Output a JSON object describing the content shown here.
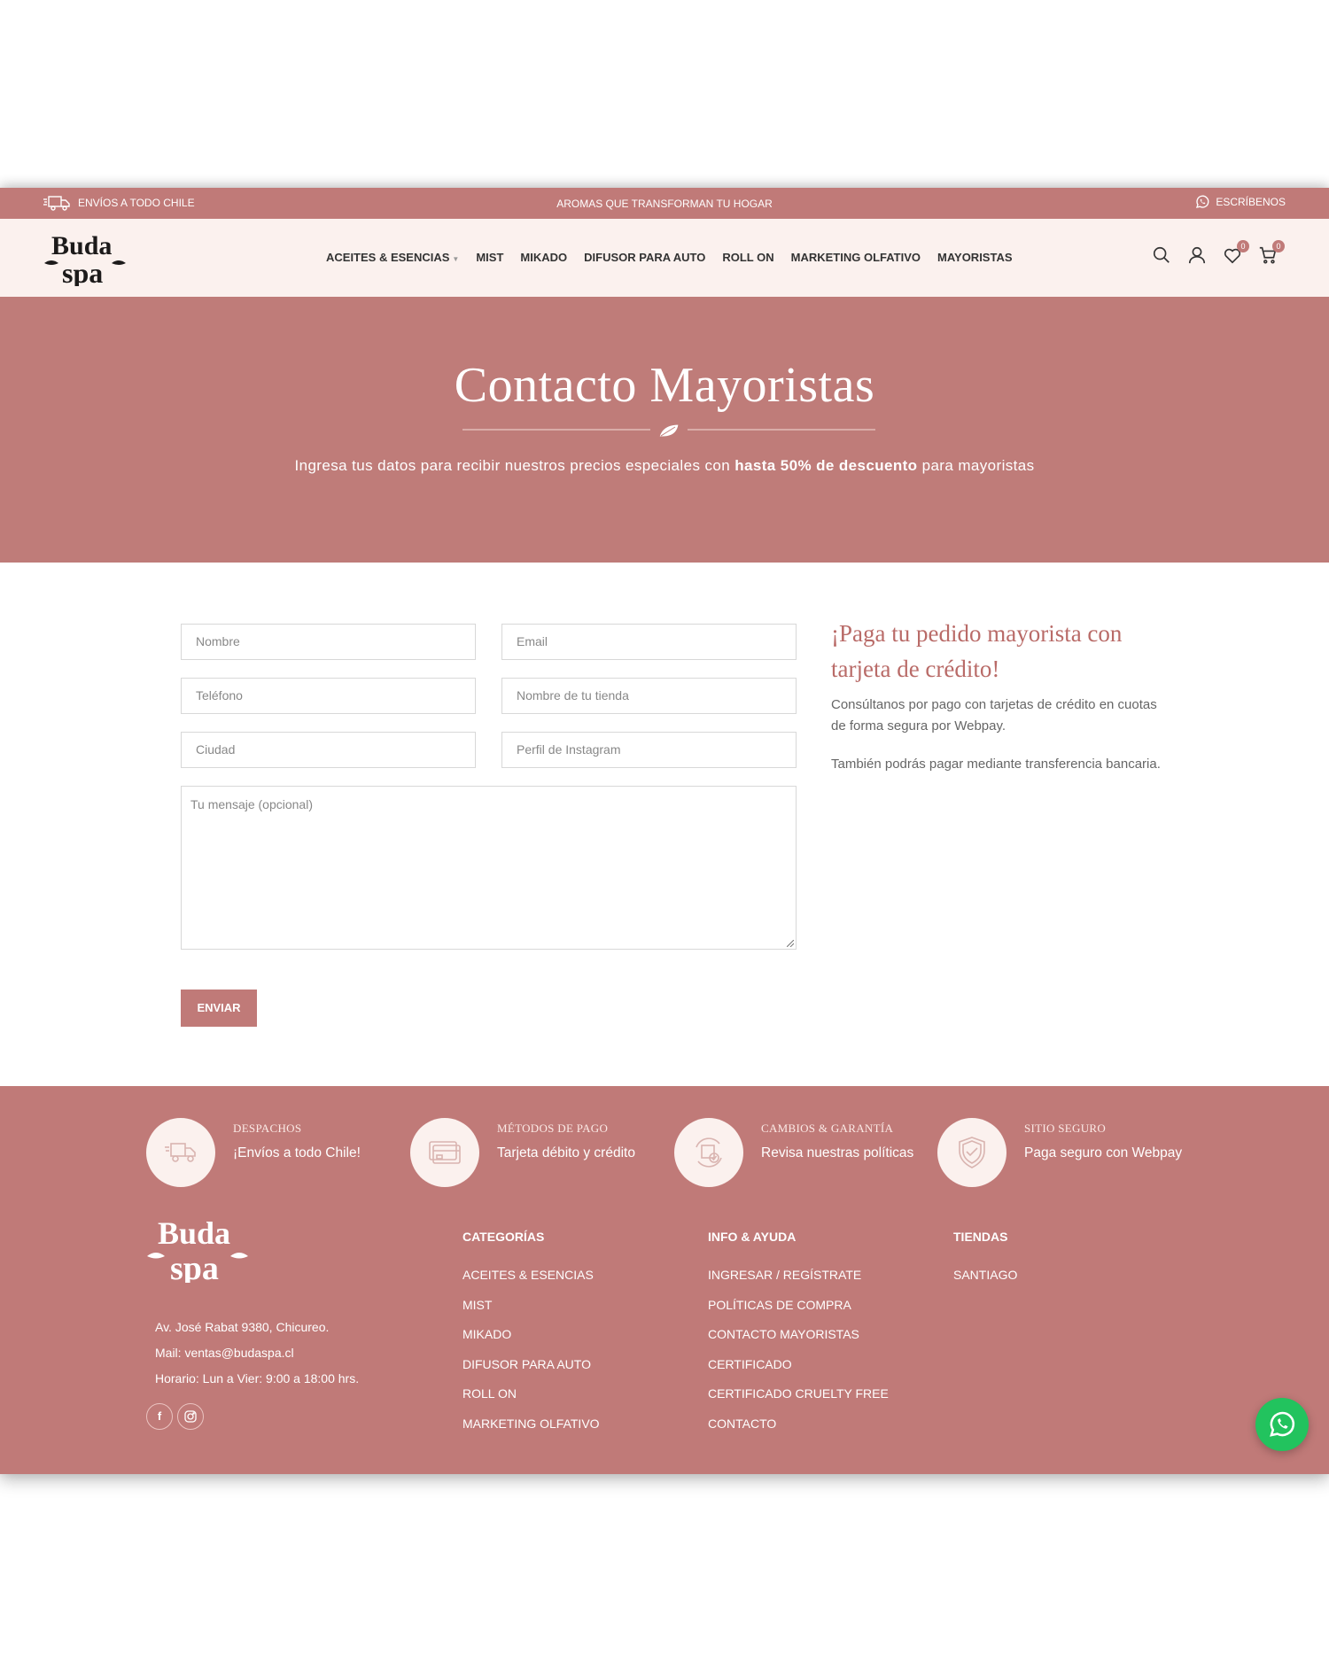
{
  "topbar": {
    "left_text": "ENVÍOS A TODO CHILE",
    "center_text": "AROMAS QUE TRANSFORMAN TU HOGAR",
    "right_text": "ESCRÍBENOS"
  },
  "header": {
    "logo_text": "Buda spa",
    "nav": [
      {
        "label": "ACEITES & ESENCIAS",
        "has_dropdown": true
      },
      {
        "label": "MIST"
      },
      {
        "label": "MIKADO"
      },
      {
        "label": "DIFUSOR PARA AUTO"
      },
      {
        "label": "ROLL ON"
      },
      {
        "label": "MARKETING OLFATIVO"
      },
      {
        "label": "MAYORISTAS"
      }
    ],
    "icons": [
      "search-icon",
      "user-icon",
      "heart-icon",
      "cart-icon"
    ],
    "wishlist_count": "0",
    "cart_count": "0"
  },
  "hero": {
    "title": "Contacto Mayoristas",
    "subtitle_pre": "Ingresa tus datos para recibir nuestros precios especiales con ",
    "subtitle_bold": "hasta 50% de descuento",
    "subtitle_post": " para mayoristas"
  },
  "form": {
    "nombre_placeholder": "Nombre",
    "email_placeholder": "Email",
    "telefono_placeholder": "Teléfono",
    "tienda_placeholder": "Nombre de tu tienda",
    "ciudad_placeholder": "Ciudad",
    "instagram_placeholder": "Perfil de Instagram",
    "mensaje_placeholder": "Tu mensaje (opcional)",
    "submit_label": "ENVIAR"
  },
  "aside": {
    "title": "¡Paga tu pedido mayorista con tarjeta de crédito!",
    "p1": "Consúltanos por pago con tarjetas de crédito en cuotas de forma segura por Webpay.",
    "p2": "También podrás pagar mediante  transferencia bancaria."
  },
  "footer": {
    "features": [
      {
        "title": "DESPACHOS",
        "text": "¡Envíos a todo Chile!",
        "icon": "truck-icon"
      },
      {
        "title": "MÉTODOS DE PAGO",
        "text": "Tarjeta débito y crédito",
        "icon": "credit-card-icon"
      },
      {
        "title": "CAMBIOS & GARANTÍA",
        "text": "Revisa nuestras políticas",
        "icon": "exchange-icon"
      },
      {
        "title": "SITIO SEGURO",
        "text": "Paga seguro con Webpay",
        "icon": "shield-icon"
      }
    ],
    "logo_text": "Buda spa",
    "address": "Av. José Rabat 9380, Chicureo.",
    "mail": "Mail: ventas@budaspa.cl",
    "hours": "Horario: Lun a Vier: 9:00 a 18:00 hrs.",
    "social": [
      "facebook-icon",
      "instagram-icon"
    ],
    "columns": [
      {
        "title": "CATEGORÍAS",
        "links": [
          "ACEITES & ESENCIAS",
          "MIST",
          "MIKADO",
          "DIFUSOR PARA AUTO",
          "ROLL ON",
          "MARKETING OLFATIVO"
        ]
      },
      {
        "title": "INFO & AYUDA",
        "links": [
          "INGRESAR / REGÍSTRATE",
          "POLÍTICAS DE COMPRA",
          "CONTACTO MAYORISTAS",
          "CERTIFICADO",
          "CERTIFICADO CRUELTY FREE",
          "CONTACTO"
        ]
      },
      {
        "title": "TIENDAS",
        "links": [
          "SANTIAGO"
        ]
      }
    ]
  },
  "colors": {
    "brand": "#c07a78",
    "header_bg": "#fbf1ee",
    "whatsapp": "#22c35e"
  }
}
